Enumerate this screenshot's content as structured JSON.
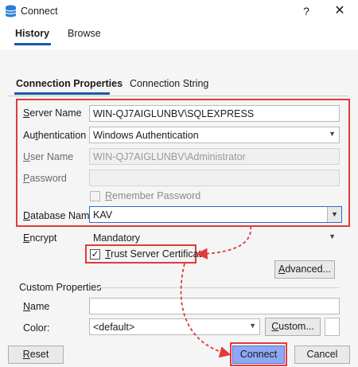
{
  "window": {
    "title": "Connect",
    "help": "?",
    "close": "✕"
  },
  "top_tabs": [
    {
      "label": "History",
      "active": true
    },
    {
      "label": "Browse",
      "active": false
    }
  ],
  "sub_tabs": [
    {
      "label": "Connection Properties",
      "active": true
    },
    {
      "label": "Connection String",
      "active": false
    }
  ],
  "form": {
    "server_name": {
      "label_ul": "S",
      "label_rest": "erver Name",
      "value": "WIN-QJ7AIGLUNBV\\SQLEXPRESS"
    },
    "authentication": {
      "label_pre": "Au",
      "label_ul": "t",
      "label_rest": "hentication",
      "value": "Windows Authentication"
    },
    "user_name": {
      "label_ul": "U",
      "label_rest": "ser Name",
      "value": "WIN-QJ7AIGLUNBV\\Administrator"
    },
    "password": {
      "label_ul": "P",
      "label_rest": "assword",
      "value": ""
    },
    "remember_password": {
      "label_ul": "R",
      "label_rest": "emember Password",
      "checked": false
    },
    "database_name": {
      "label_ul": "D",
      "label_rest": "atabase Name",
      "value": "KAV"
    },
    "encrypt": {
      "label_ul": "E",
      "label_rest": "ncrypt",
      "value": "Mandatory"
    },
    "trust_server_certificate": {
      "label_ul": "T",
      "label_rest": "rust Server Certificate",
      "checked": true,
      "check_glyph": "✓"
    },
    "advanced_button": {
      "label_ul": "A",
      "label_rest": "dvanced..."
    }
  },
  "custom_properties": {
    "heading": "Custom Properties",
    "name": {
      "label_ul": "N",
      "label_rest": "ame",
      "value": ""
    },
    "color": {
      "label": "Color:",
      "value": "<default>"
    },
    "custom_button": {
      "label_ul": "C",
      "label_rest": "ustom..."
    }
  },
  "footer": {
    "reset": {
      "label_ul": "R",
      "label_rest": "eset"
    },
    "connect": "Connect",
    "cancel": "Cancel"
  },
  "colors": {
    "accent": "#1a5aa6",
    "highlight": "#e23a3a",
    "primary_button": "#8ea8f5"
  },
  "icons": {
    "app": "database-icon",
    "dropdown": "chevron-down-icon",
    "check": "checkmark-icon"
  }
}
